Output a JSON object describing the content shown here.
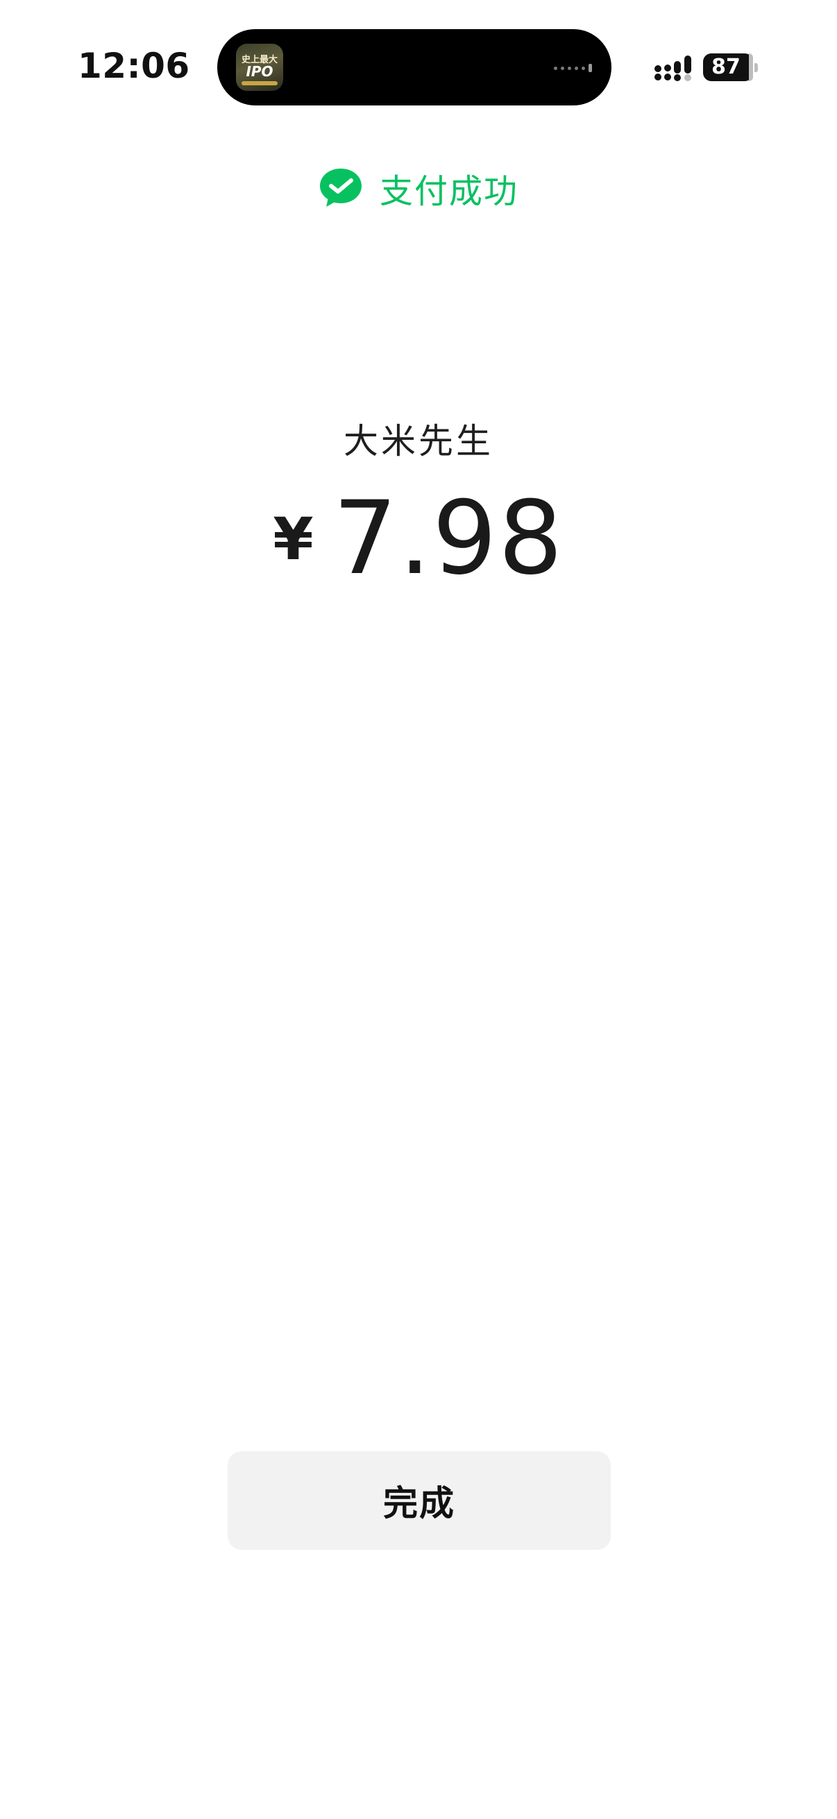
{
  "status_bar": {
    "time": "12:06",
    "battery_level": "87",
    "signal_icon": "cellular-signal-icon",
    "island_app": {
      "icon_name": "app-activity-icon",
      "icon_text_line1": "史上最大",
      "icon_text_line2": "IPO"
    }
  },
  "payment": {
    "status_icon": "wechat-pay-icon",
    "status_text": "支付成功",
    "status_color": "#07c160",
    "merchant": "大米先生",
    "currency_symbol": "¥",
    "amount": "7.98"
  },
  "actions": {
    "done_label": "完成"
  }
}
